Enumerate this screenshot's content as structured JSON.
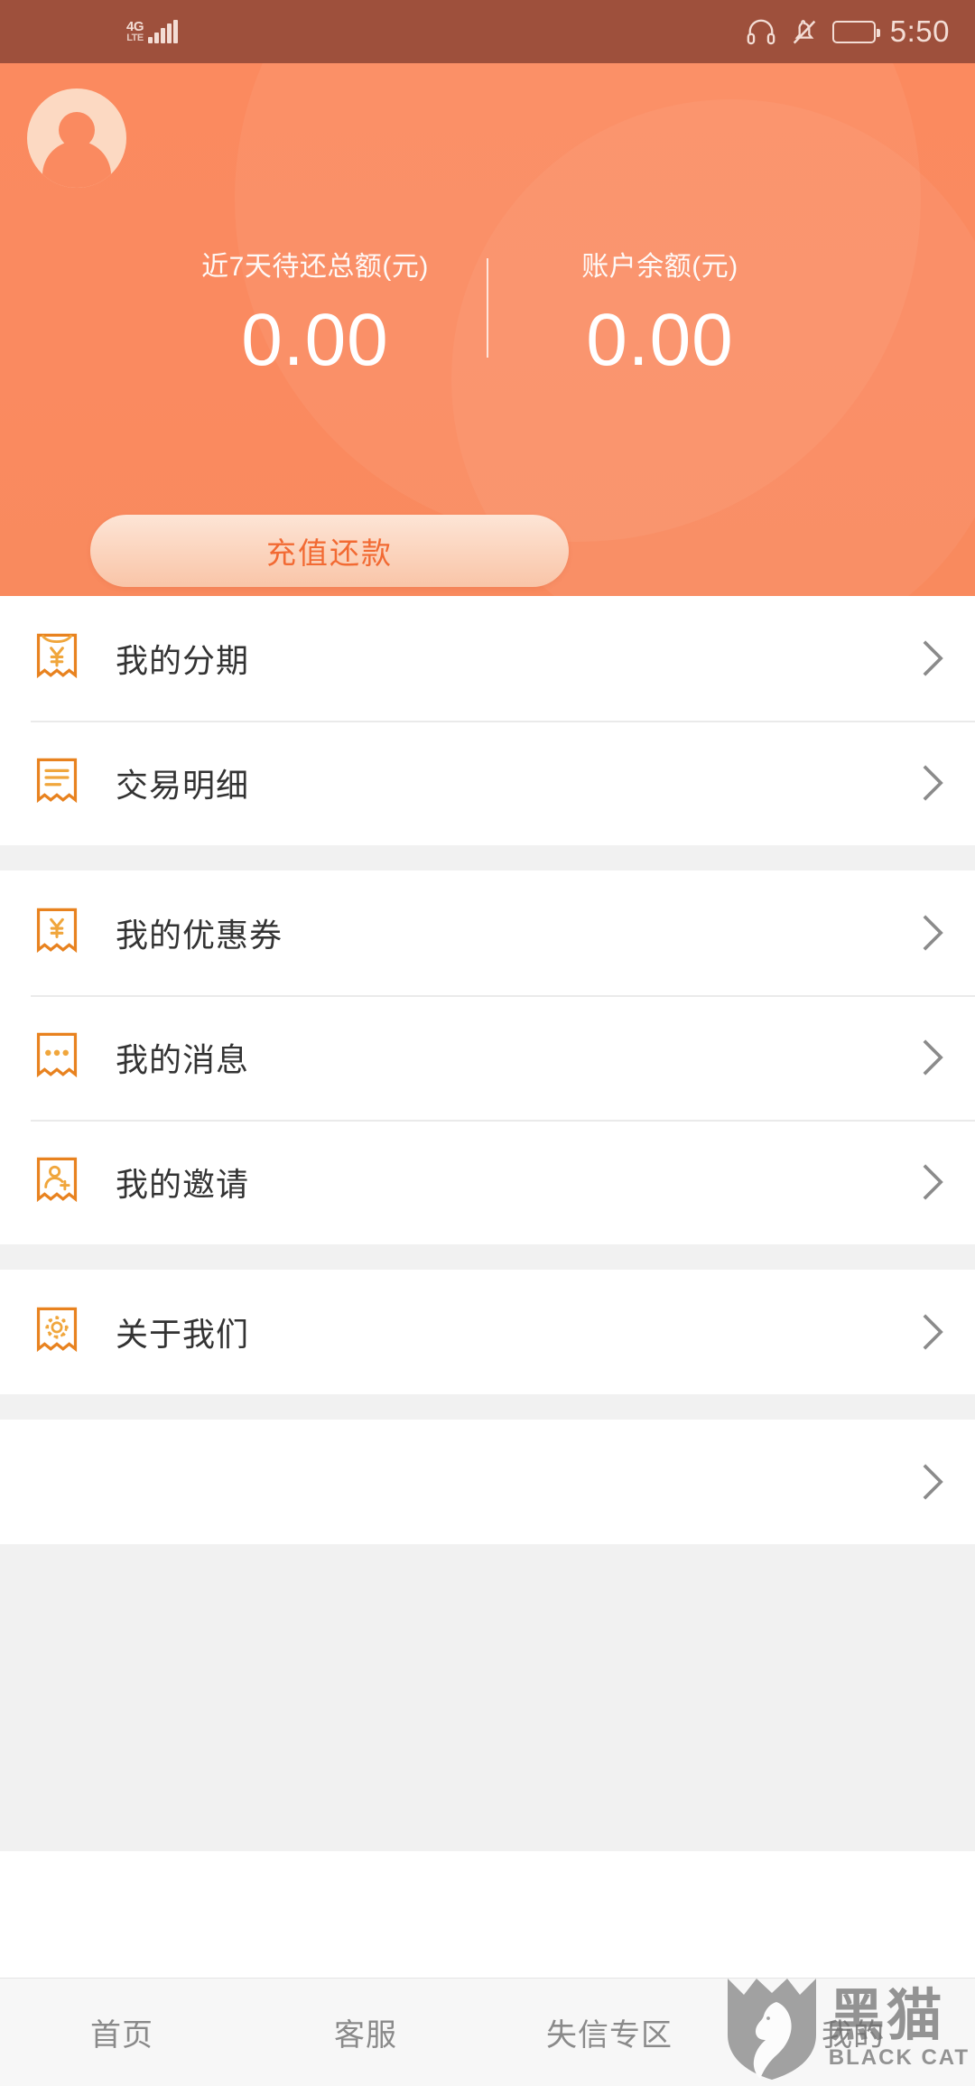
{
  "statusbar": {
    "network": "4G",
    "network_sub": "LTE",
    "signal_icon": "signal-bars-icon",
    "headphone_icon": "headphones-icon",
    "mute_icon": "bell-muted-icon",
    "battery_icon": "battery-icon",
    "time": "5:50"
  },
  "header": {
    "avatar_icon": "user-avatar-icon",
    "stats": [
      {
        "label": "近7天待还总额(元)",
        "value": "0.00"
      },
      {
        "label": "账户余额(元)",
        "value": "0.00"
      }
    ],
    "cta_label": "充值还款",
    "accent_color": "#fa8a60",
    "cta_text_color": "#f26a33"
  },
  "menu": {
    "groups": [
      {
        "items": [
          {
            "icon": "receipt-yuan-icon",
            "label": "我的分期",
            "chevron": "chevron-right-icon"
          },
          {
            "icon": "receipt-lines-icon",
            "label": "交易明细",
            "chevron": "chevron-right-icon"
          }
        ]
      },
      {
        "items": [
          {
            "icon": "receipt-yuan-icon",
            "label": "我的优惠券",
            "chevron": "chevron-right-icon"
          },
          {
            "icon": "receipt-dots-icon",
            "label": "我的消息",
            "chevron": "chevron-right-icon"
          },
          {
            "icon": "receipt-user-add-icon",
            "label": "我的邀请",
            "chevron": "chevron-right-icon"
          }
        ]
      },
      {
        "items": [
          {
            "icon": "receipt-gear-icon",
            "label": "关于我们",
            "chevron": "chevron-right-icon"
          }
        ]
      },
      {
        "items": [
          {
            "icon": "",
            "label": "",
            "chevron": "chevron-right-icon"
          }
        ]
      }
    ]
  },
  "tabbar": {
    "items": [
      {
        "label": "首页"
      },
      {
        "label": "客服"
      },
      {
        "label": "失信专区"
      },
      {
        "label": "我的"
      }
    ]
  },
  "watermark": {
    "cn": "黑猫",
    "en": "BLACK CAT",
    "shield_icon": "black-cat-shield-icon"
  }
}
